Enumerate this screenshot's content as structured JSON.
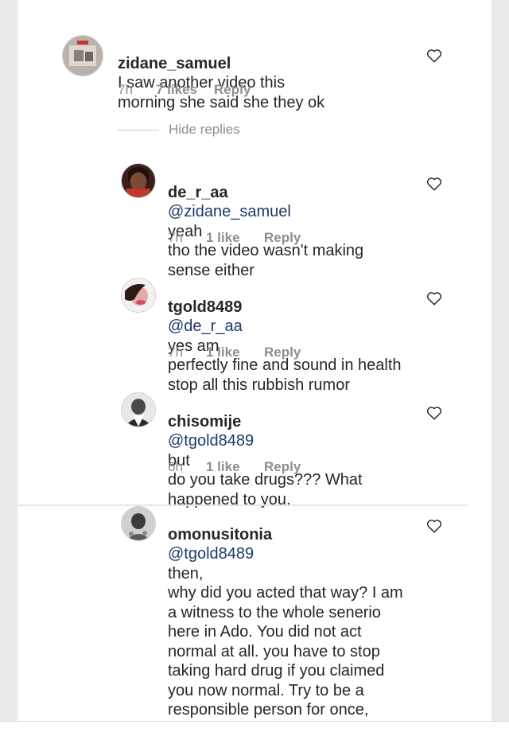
{
  "comments": [
    {
      "username": "zidane_samuel",
      "mention": "",
      "text": "I saw another video this\nmorning she said she they ok",
      "time": "7h",
      "likes": "7 likes",
      "reply": "Reply"
    },
    {
      "username": "de_r_aa",
      "mention": "@zidane_samuel",
      "text": "yeah\ntho the video wasn't making\nsense either",
      "time": "7h",
      "likes": "1 like",
      "reply": "Reply"
    },
    {
      "username": "tgold8489",
      "mention": "@de_r_aa",
      "text": "yes am\nperfectly fine and sound in health\nstop all this rubbish rumor",
      "time": "7h",
      "likes": "1 like",
      "reply": "Reply"
    },
    {
      "username": "chisomije",
      "mention": "@tgold8489",
      "text": "but\ndo you take drugs??? What\nhappened to you.",
      "time": "6h",
      "likes": "1 like",
      "reply": "Reply"
    },
    {
      "username": "omonusitonia",
      "mention": "@tgold8489",
      "text": "then,\nwhy did you acted that way? I am\na witness to the whole senerio\nhere in Ado. You did not act\nnormal at all. you have to stop\ntaking hard drug if you claimed\nyou now normal. Try to be a\nresponsible person for once,\nstop taking  hard drug all in the\nname of satisfying one useless\nguy. Just my opinion though!",
      "time": "",
      "likes": "",
      "reply": ""
    }
  ],
  "thread": {
    "hide_replies": "Hide replies"
  },
  "colors": {
    "text": "#262626",
    "meta": "#8e8e8e",
    "mention": "#1c3a6a"
  },
  "icons": {
    "like": "heart-outline-icon"
  }
}
